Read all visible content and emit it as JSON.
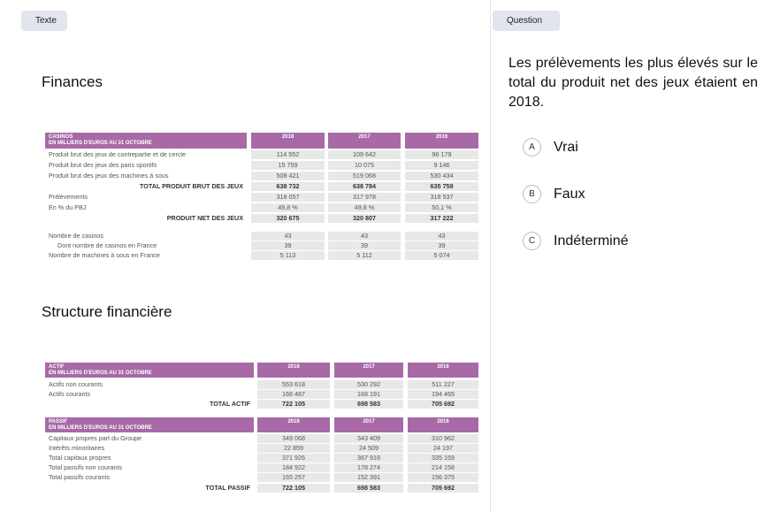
{
  "tabs": {
    "texte": "Texte",
    "question": "Question"
  },
  "headings": {
    "finances": "Finances",
    "structure": "Structure financière"
  },
  "casinos_table": {
    "header_line1": "CASINOS",
    "header_line2": "EN MILLIERS D'EUROS AU 31 OCTOBRE",
    "years": [
      "2018",
      "2017",
      "2016"
    ],
    "rows": [
      {
        "label": "Produit brut des jeux de contrepartie et de cercle",
        "values": [
          "114 552",
          "109 642",
          "96 179"
        ]
      },
      {
        "label": "Produit brut des jeux des paris sportifs",
        "values": [
          "15 759",
          "10 075",
          "9 146"
        ]
      },
      {
        "label": "Produit brut des jeux des machines à sous",
        "values": [
          "508 421",
          "519 068",
          "530 434"
        ]
      },
      {
        "label": "TOTAL PRODUIT BRUT DES JEUX",
        "values": [
          "638 732",
          "638 784",
          "635 759"
        ]
      },
      {
        "label": "Prélèvements",
        "values": [
          "318 057",
          "317 978",
          "318 537"
        ]
      },
      {
        "label": "En % du PBJ",
        "values": [
          "49,8 %",
          "49,8 %",
          "50,1 %"
        ]
      },
      {
        "label": "PRODUIT NET DES JEUX",
        "values": [
          "320 675",
          "320 807",
          "317 222"
        ]
      },
      {
        "label": "Nombre de casinos",
        "values": [
          "43",
          "43",
          "43"
        ]
      },
      {
        "label": "Dont nombre de casinos en France",
        "values": [
          "39",
          "39",
          "39"
        ]
      },
      {
        "label": "Nombre de machines à sous  en France",
        "values": [
          "5 113",
          "5 112",
          "5 074"
        ]
      }
    ]
  },
  "actif_table": {
    "header_line1": "ACTIF",
    "header_line2": "EN MILLIERS D'EUROS AU 31 OCTOBRE",
    "years": [
      "2018",
      "2017",
      "2016"
    ],
    "rows": [
      {
        "label": "Actifs non courants",
        "values": [
          "553 618",
          "530 292",
          "511 227"
        ]
      },
      {
        "label": "Actifs courants",
        "values": [
          "168 487",
          "168 191",
          "194 465"
        ]
      },
      {
        "label": "TOTAL ACTIF",
        "values": [
          "722 105",
          "698 583",
          "705 692"
        ]
      }
    ]
  },
  "passif_table": {
    "header_line1": "PASSIF",
    "header_line2": "EN MILLIERS D'EUROS AU 31 OCTOBRE",
    "years": [
      "2018",
      "2017",
      "2016"
    ],
    "rows": [
      {
        "label": "Capitaux propres part du Groupe",
        "values": [
          "349 068",
          "343 409",
          "310 962"
        ]
      },
      {
        "label": "Intérêts minoritaires",
        "values": [
          "22 859",
          "24 509",
          "24 197"
        ]
      },
      {
        "label": "Total capitaux propres",
        "values": [
          "371 926",
          "367 918",
          "335 159"
        ]
      },
      {
        "label": "Total passifs non courants",
        "values": [
          "184 922",
          "178 274",
          "214 158"
        ]
      },
      {
        "label": "Total passifs courants",
        "values": [
          "165 257",
          "152 391",
          "156 375"
        ]
      },
      {
        "label": "TOTAL PASSIF",
        "values": [
          "722 105",
          "698 583",
          "705 692"
        ]
      }
    ]
  },
  "question": {
    "text": "Les prélèvements les plus élevés sur le total du produit net des jeux étaient en 2018.",
    "options": [
      {
        "letter": "A",
        "label": "Vrai"
      },
      {
        "letter": "B",
        "label": "Faux"
      },
      {
        "letter": "C",
        "label": "Indéterminé"
      }
    ]
  }
}
